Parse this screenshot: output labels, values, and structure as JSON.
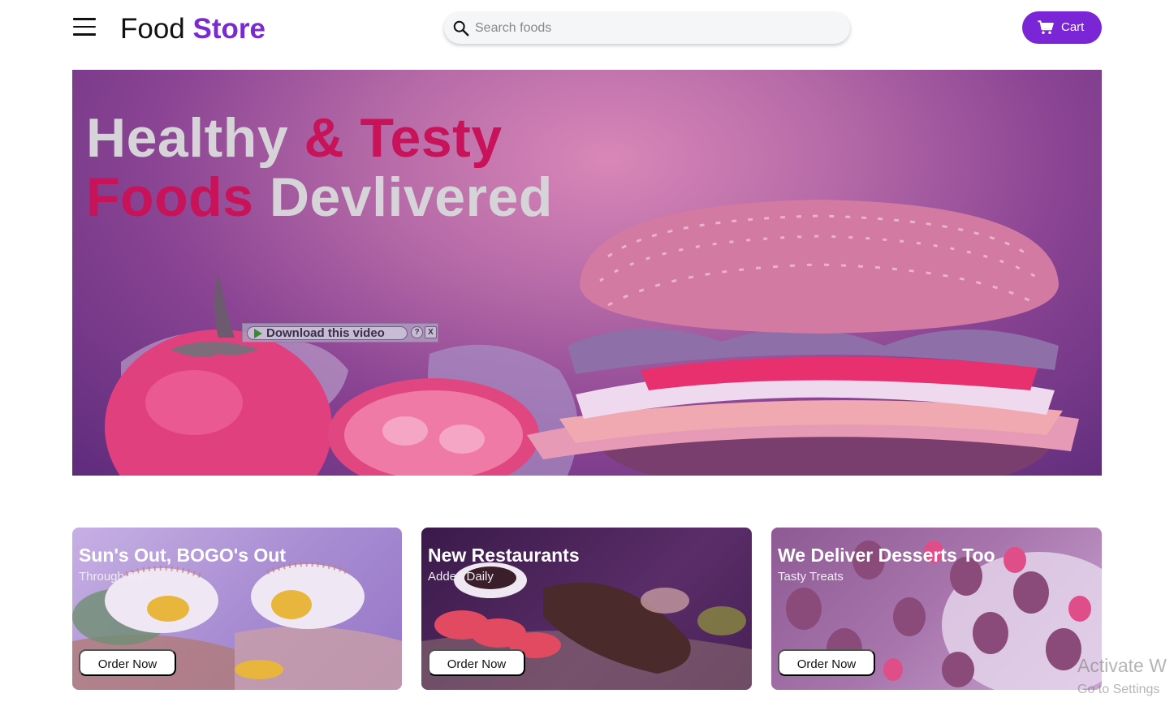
{
  "header": {
    "brand_part1": "Food",
    "brand_part2": "Store",
    "search_placeholder": "Search foods",
    "cart_label": "Cart",
    "icons": {
      "menu": "hamburger-menu-icon",
      "search": "search-icon",
      "cart": "cart-icon"
    }
  },
  "hero": {
    "line1_word1": "Healthy",
    "line1_word2": "& Testy",
    "line2_word1": "Foods",
    "line2_word2": "Devlivered",
    "overlay": {
      "download_label": "Download this video",
      "help_label": "?",
      "close_label": "X"
    }
  },
  "cards": [
    {
      "title": "Sun's Out, BOGO's Out",
      "subtitle": "Through 8/26",
      "button": "Order Now"
    },
    {
      "title": "New Restaurants",
      "subtitle": "Added Daily",
      "button": "Order Now"
    },
    {
      "title": "We Deliver Desserts Too",
      "subtitle": "Tasty Treats",
      "button": "Order Now"
    }
  ],
  "watermark": {
    "line1": "Activate W",
    "line2": "Go to Settings"
  },
  "colors": {
    "brand_accent": "#7a26d6",
    "hero_accent": "#c8125a",
    "hero_light": "#d6d3d9"
  }
}
